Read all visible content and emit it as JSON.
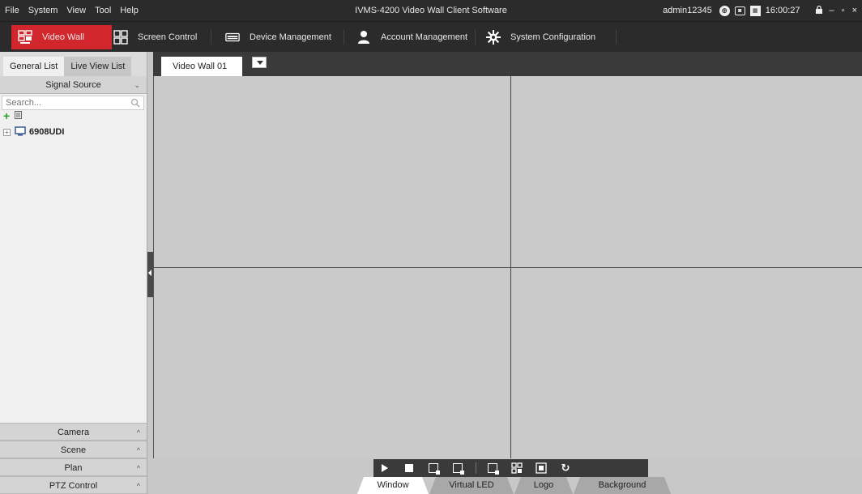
{
  "titlebar": {
    "menu": [
      "File",
      "System",
      "View",
      "Tool",
      "Help"
    ],
    "app_title": "IVMS-4200 Video Wall Client Software",
    "user": "admin12345",
    "time": "16:00:27",
    "icons": [
      "network-status-icon",
      "alarm-status-icon",
      "calendar-icon",
      "lock-icon",
      "minimize-icon",
      "maximize-icon",
      "close-icon"
    ],
    "minimize": "–",
    "maximize": "▫",
    "close": "×"
  },
  "nav": {
    "items": [
      {
        "label": "Video Wall",
        "icon": "video-wall-icon",
        "active": true
      },
      {
        "label": "Screen Control",
        "icon": "screen-control-icon",
        "active": false
      },
      {
        "label": "Device Management",
        "icon": "device-management-icon",
        "active": false
      },
      {
        "label": "Account Management",
        "icon": "account-management-icon",
        "active": false
      },
      {
        "label": "System Configuration",
        "icon": "system-configuration-icon",
        "active": false
      }
    ],
    "active_color": "#d1262c"
  },
  "left_panel": {
    "tabs": [
      "General List",
      "Live View List"
    ],
    "active_tab": "General List",
    "signal_source": {
      "title": "Signal Source",
      "search_placeholder": "Search...",
      "tree": [
        {
          "label": "6908UDI",
          "expander": "+"
        }
      ]
    },
    "sections": [
      "Camera",
      "Scene",
      "Plan",
      "PTZ Control"
    ]
  },
  "main": {
    "wall_tab": "Video Wall 01",
    "grid": {
      "rows": 2,
      "cols": 2
    }
  },
  "bottom": {
    "controls": [
      "play",
      "stop",
      "close-window",
      "output-window",
      "capture",
      "split-screen",
      "fullscreen",
      "refresh"
    ],
    "mode_tabs": [
      "Window",
      "Virtual LED",
      "Logo",
      "Background Picture"
    ],
    "active_mode": "Window"
  }
}
